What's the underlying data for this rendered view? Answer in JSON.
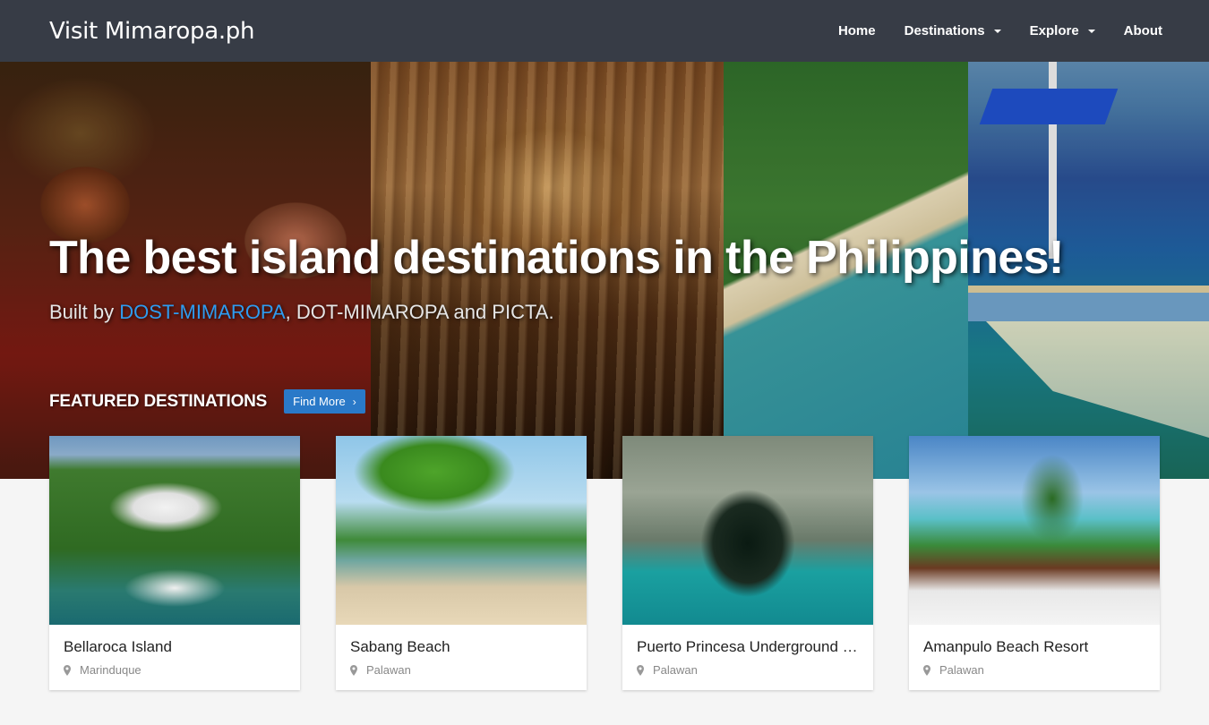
{
  "navbar": {
    "brand": "Visit Mimaropa.ph",
    "items": [
      {
        "label": "Home",
        "dropdown": false
      },
      {
        "label": "Destinations",
        "dropdown": true
      },
      {
        "label": "Explore",
        "dropdown": true
      },
      {
        "label": "About",
        "dropdown": false
      }
    ]
  },
  "hero": {
    "title": "The best island destinations in the Philippines!",
    "subtitle_prefix": "Built by ",
    "subtitle_highlight": "DOST-MIMAROPA",
    "subtitle_suffix": ", DOT-MIMAROPA and PICTA.",
    "highlight_color": "#2e9cf0"
  },
  "featured": {
    "label": "FEATURED DESTINATIONS",
    "button_label": "Find More",
    "button_icon": "chevron-right-icon"
  },
  "cards": [
    {
      "title": "Bellaroca Island",
      "location": "Marinduque"
    },
    {
      "title": "Sabang Beach",
      "location": "Palawan"
    },
    {
      "title": "Puerto Princesa Underground …",
      "location": "Palawan"
    },
    {
      "title": "Amanpulo Beach Resort",
      "location": "Palawan"
    }
  ],
  "colors": {
    "navbar_bg": "#373c46",
    "button_bg": "#2a79c8",
    "page_bg": "#f5f5f5"
  }
}
